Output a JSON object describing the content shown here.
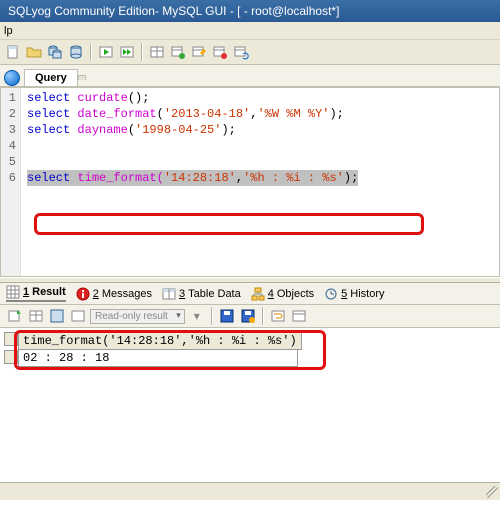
{
  "window": {
    "title": "SQLyog Community Edition- MySQL GUI - [ - root@localhost*]"
  },
  "menu": {
    "help": "lp"
  },
  "toolbar_icons": [
    "new",
    "open",
    "save",
    "db",
    "sep",
    "copy",
    "paste",
    "undo",
    "redo",
    "sep",
    "tbl1",
    "tbl2",
    "tbl3",
    "tbl4",
    "tbl5"
  ],
  "query_tab": {
    "label": "Query"
  },
  "code_lines": {
    "l1a": "select",
    "l1b": " curdate",
    "l1c": "();",
    "l2a": "select",
    "l2b": " date_format",
    "l2c": "(",
    "l2d": "'2013-04-18'",
    "l2e": ",",
    "l2f": "'%W %M %Y'",
    "l2g": ");",
    "l3a": "select",
    "l3b": " dayname",
    "l3c": "(",
    "l3d": "'1998-04-25'",
    "l3e": ");",
    "l6a": "select",
    "l6b": " time_format(",
    "l6c": "'14:28:18'",
    "l6d": ",",
    "l6e": "'%h : %i : %s'",
    "l6f": ");"
  },
  "gutter": [
    "1",
    "2",
    "3",
    "4",
    "5",
    "6"
  ],
  "result_tabs": {
    "t1_num": "1",
    "t1_lbl": "Result",
    "t2_num": "2",
    "t2_lbl": "Messages",
    "t3_num": "3",
    "t3_lbl": "Table Data",
    "t4_num": "4",
    "t4_lbl": "Objects",
    "t5_num": "5",
    "t5_lbl": "History"
  },
  "result_toolbar": {
    "readonly": "Read-only result"
  },
  "result": {
    "header": "time_format('14:28:18','%h : %i : %s')",
    "row1": "02 : 28 : 18"
  },
  "colors": {
    "highlight_border": "#e01010"
  }
}
